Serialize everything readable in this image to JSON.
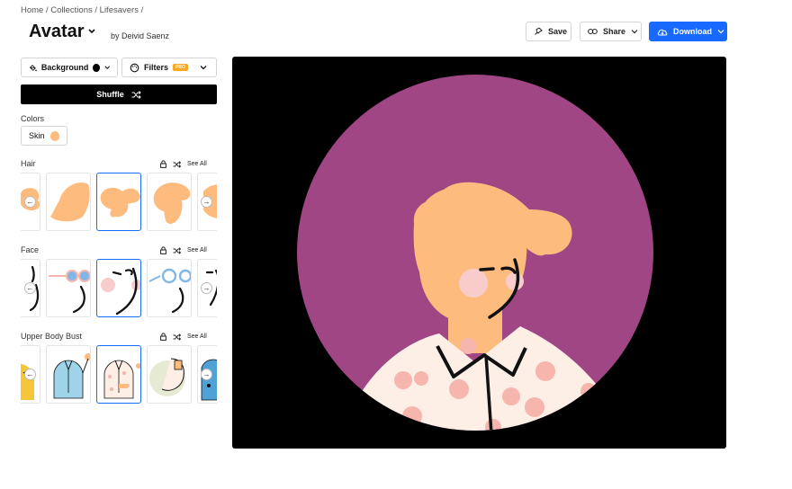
{
  "breadcrumb": {
    "home": "Home",
    "collections": "Collections",
    "current": "Lifesavers",
    "separator": "/"
  },
  "header": {
    "title": "Avatar",
    "byline": "by Deivid Saenz"
  },
  "actions": {
    "save": "Save",
    "share": "Share",
    "download": "Download"
  },
  "controls": {
    "background_label": "Background",
    "filters_label": "Filters",
    "pro_badge": "PRO",
    "shuffle_label": "Shuffle"
  },
  "colors": {
    "section_label": "Colors",
    "skin_label": "Skin",
    "skin_color": "#fdbc7d"
  },
  "sections": {
    "hair": {
      "label": "Hair",
      "see_all": "See All"
    },
    "face": {
      "label": "Face",
      "see_all": "See All"
    },
    "upper_body": {
      "label": "Upper Body Bust",
      "see_all": "See All"
    }
  },
  "theme": {
    "accent": "#1769ff",
    "canvas_bg": "#000000",
    "circle_bg": "#a04685",
    "shirt": "#fdeee6",
    "shirt_dots": "#f6b5ad",
    "pro": "#f7a826"
  }
}
